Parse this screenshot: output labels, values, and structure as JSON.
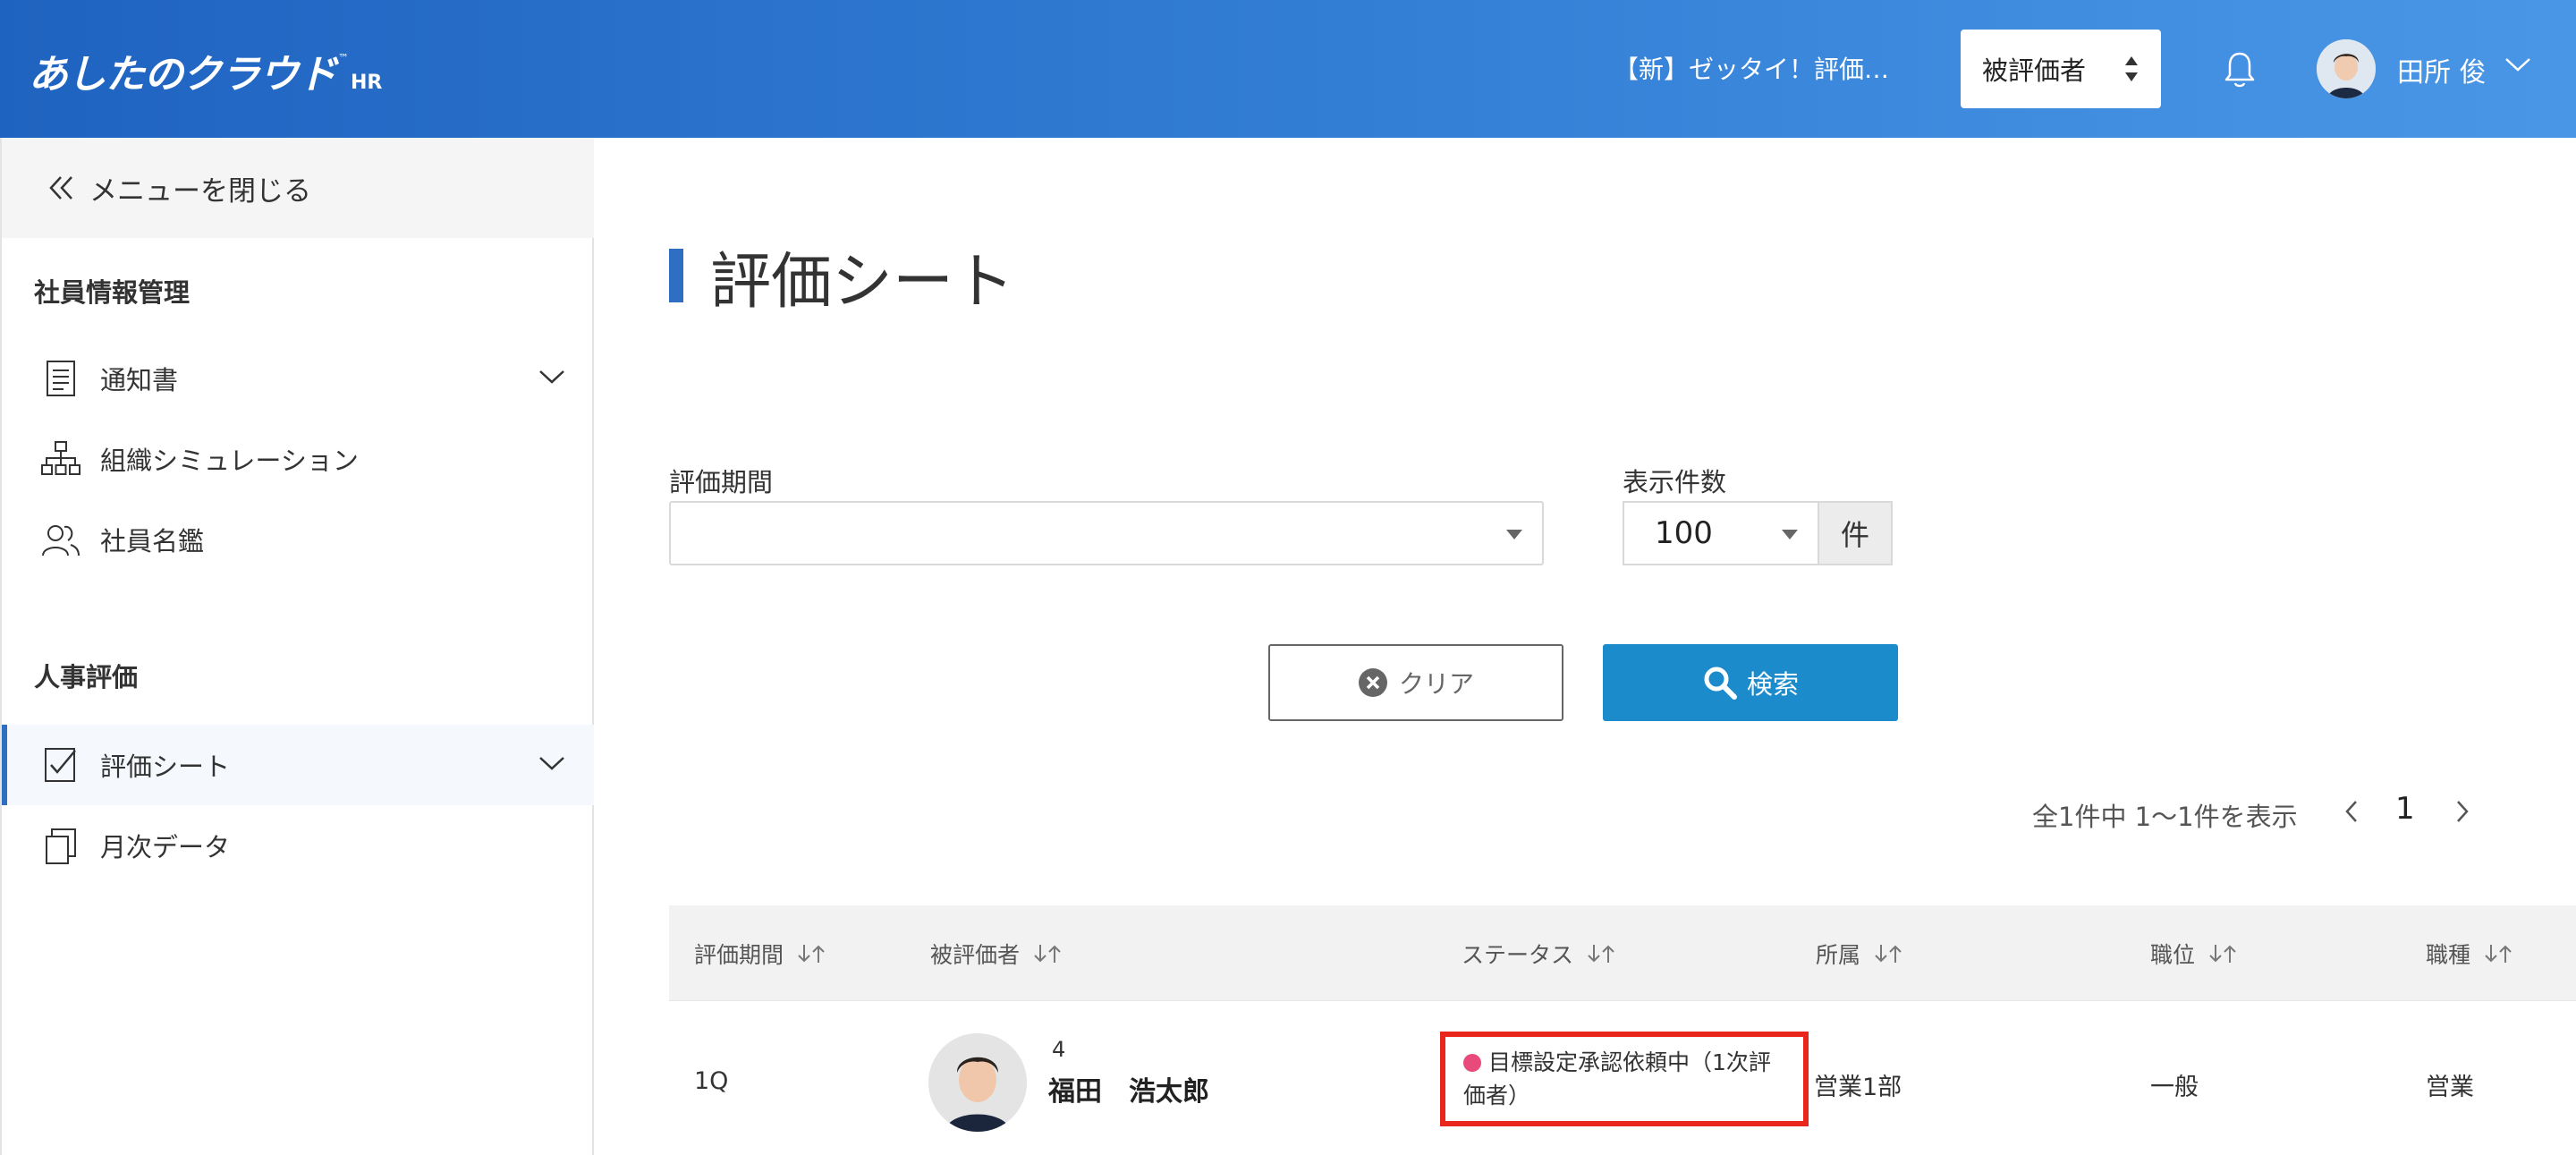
{
  "header": {
    "logo_main": "あしたのクラウド",
    "logo_tm": "™",
    "logo_suffix": "HR",
    "period_title": "【新】ゼッタイ！評価…",
    "role_select_value": "被評価者",
    "user_name": "田所 俊"
  },
  "sidebar": {
    "close_menu_label": "メニューを閉じる",
    "sections": [
      {
        "title": "社員情報管理",
        "items": [
          {
            "label": "通知書",
            "icon": "document-icon",
            "expandable": true
          },
          {
            "label": "組織シミュレーション",
            "icon": "org-chart-icon",
            "expandable": false
          },
          {
            "label": "社員名鑑",
            "icon": "people-icon",
            "expandable": false
          }
        ]
      },
      {
        "title": "人事評価",
        "items": [
          {
            "label": "評価シート",
            "icon": "checked-sheet-icon",
            "expandable": true,
            "active": true
          },
          {
            "label": "月次データ",
            "icon": "copy-icon",
            "expandable": false
          }
        ]
      }
    ]
  },
  "main": {
    "page_title": "評価シート",
    "filters": {
      "period_label": "評価期間",
      "period_value": "",
      "count_label": "表示件数",
      "count_value": "100",
      "count_unit": "件"
    },
    "buttons": {
      "clear_label": "クリア",
      "search_label": "検索"
    },
    "pagination": {
      "summary": "全1件中 1〜1件を表示",
      "current_page": "1"
    },
    "table": {
      "columns": [
        "評価期間",
        "被評価者",
        "ステータス",
        "所属",
        "職位",
        "職種"
      ],
      "rows": [
        {
          "period": "1Q",
          "employee_no": "4",
          "employee_name": "福田　浩太郎",
          "status_line1": "目標設定承認依頼中（1次評",
          "status_line2": "価者）",
          "department": "営業1部",
          "position": "一般",
          "job_type": "営業"
        }
      ]
    },
    "colors": {
      "header_gradient_start": "#1f63c0",
      "header_gradient_end": "#4a96e6",
      "accent": "#2e6fc4",
      "search_button": "#1b8bcc",
      "status_dot": "#e94a7c",
      "highlight_border": "#e8261c"
    }
  }
}
